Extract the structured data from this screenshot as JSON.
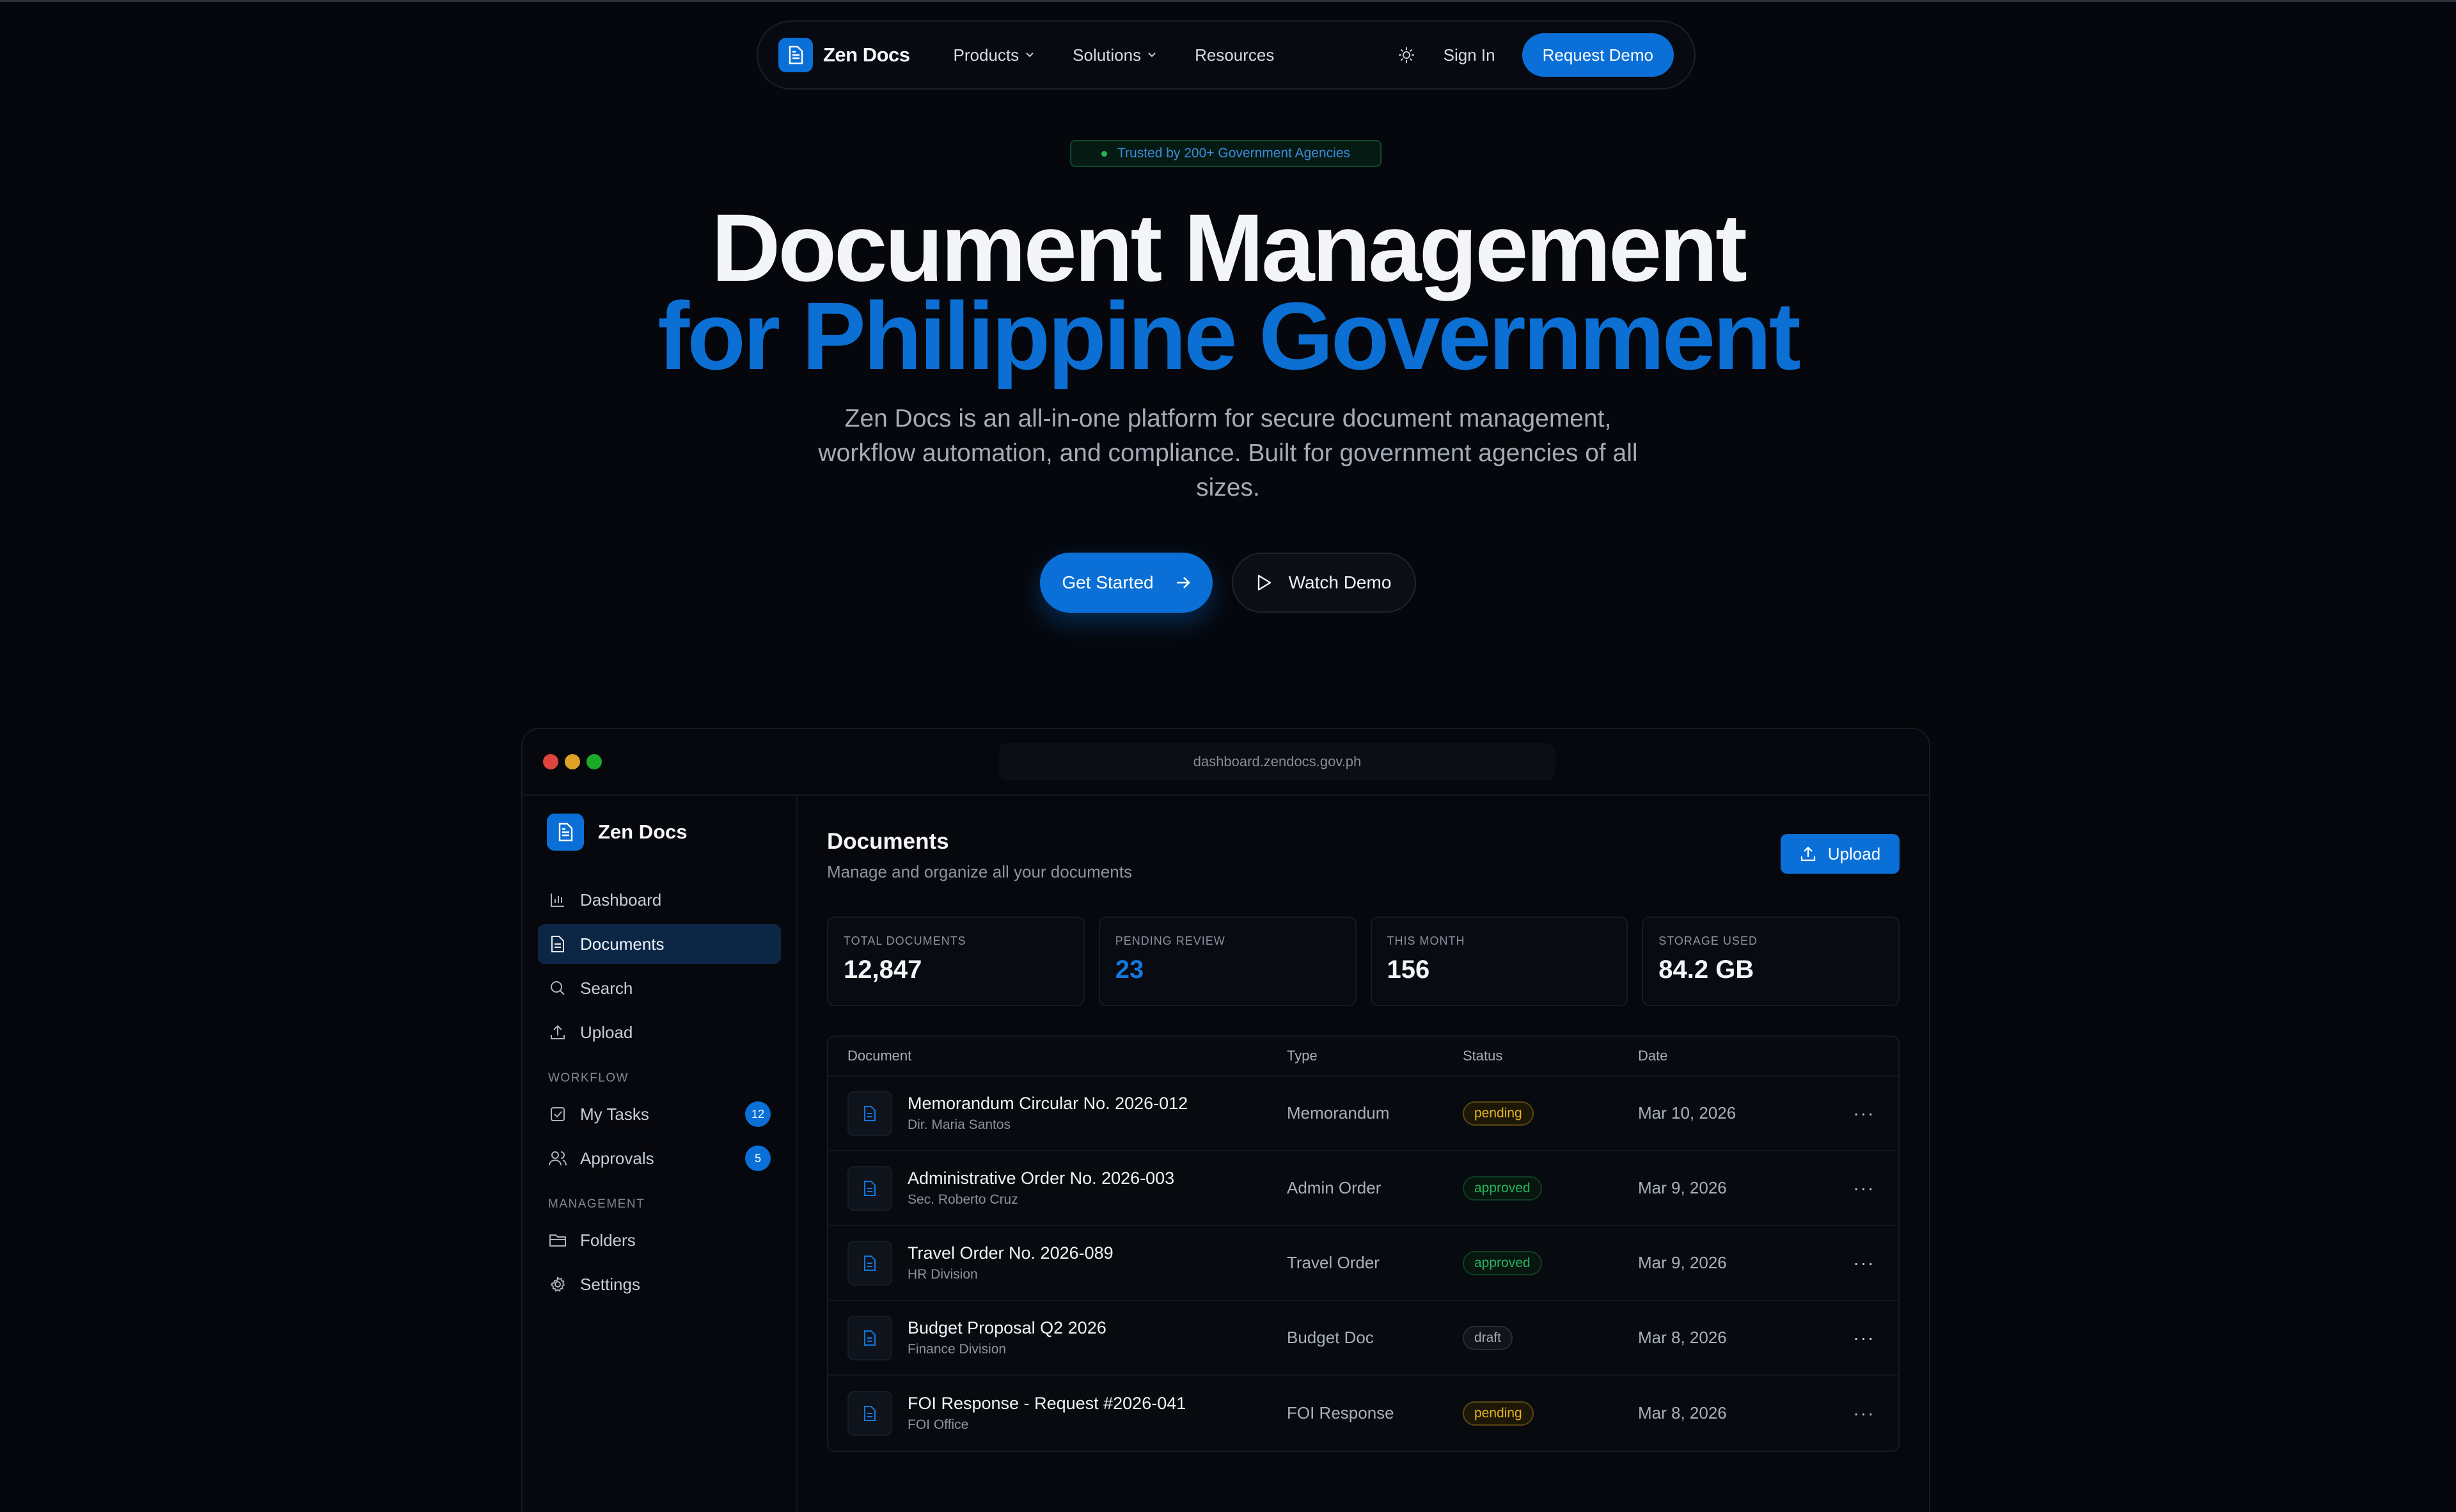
{
  "nav": {
    "brand": "Zen Docs",
    "links": [
      "Products",
      "Solutions",
      "Resources"
    ],
    "sign_in": "Sign In",
    "request_demo": "Request Demo"
  },
  "hero": {
    "badge": "Trusted by 200+ Government Agencies",
    "title_line1": "Document Management",
    "title_line2": "for Philippine Government",
    "lede": "Zen Docs is an all-in-one platform for secure document management, workflow automation, and compliance. Built for government agencies of all sizes.",
    "get_started": "Get Started",
    "watch_demo": "Watch Demo"
  },
  "app": {
    "url": "dashboard.zendocs.gov.ph",
    "brand": "Zen Docs",
    "sidebar": {
      "main": [
        {
          "label": "Dashboard",
          "icon": "bar-chart-icon"
        },
        {
          "label": "Documents",
          "icon": "file-icon",
          "active": true
        },
        {
          "label": "Search",
          "icon": "search-icon"
        },
        {
          "label": "Upload",
          "icon": "upload-icon"
        }
      ],
      "workflow_heading": "WORKFLOW",
      "workflow": [
        {
          "label": "My Tasks",
          "icon": "check-square-icon",
          "count": "12"
        },
        {
          "label": "Approvals",
          "icon": "users-icon",
          "count": "5"
        }
      ],
      "management_heading": "MANAGEMENT",
      "management": [
        {
          "label": "Folders",
          "icon": "folder-icon"
        },
        {
          "label": "Settings",
          "icon": "gear-icon"
        }
      ]
    },
    "page_title": "Documents",
    "page_subtitle": "Manage and organize all your documents",
    "upload_label": "Upload",
    "stats": [
      {
        "label": "TOTAL DOCUMENTS",
        "value": "12,847"
      },
      {
        "label": "PENDING REVIEW",
        "value": "23"
      },
      {
        "label": "THIS MONTH",
        "value": "156"
      },
      {
        "label": "STORAGE USED",
        "value": "84.2 GB"
      }
    ],
    "table": {
      "headers": [
        "Document",
        "Type",
        "Status",
        "Date"
      ],
      "rows": [
        {
          "title": "Memorandum Circular No. 2026-012",
          "author": "Dir. Maria Santos",
          "type": "Memorandum",
          "status": "pending",
          "date": "Mar 10, 2026"
        },
        {
          "title": "Administrative Order No. 2026-003",
          "author": "Sec. Roberto Cruz",
          "type": "Admin Order",
          "status": "approved",
          "date": "Mar 9, 2026"
        },
        {
          "title": "Travel Order No. 2026-089",
          "author": "HR Division",
          "type": "Travel Order",
          "status": "approved",
          "date": "Mar 9, 2026"
        },
        {
          "title": "Budget Proposal Q2 2026",
          "author": "Finance Division",
          "type": "Budget Doc",
          "status": "draft",
          "date": "Mar 8, 2026"
        },
        {
          "title": "FOI Response - Request #2026-041",
          "author": "FOI Office",
          "type": "FOI Response",
          "status": "pending",
          "date": "Mar 8, 2026"
        }
      ]
    }
  },
  "colors": {
    "accent": "#0a6fd6",
    "background": "#05070c",
    "pending": "#e7b320",
    "approved": "#27b45f"
  }
}
